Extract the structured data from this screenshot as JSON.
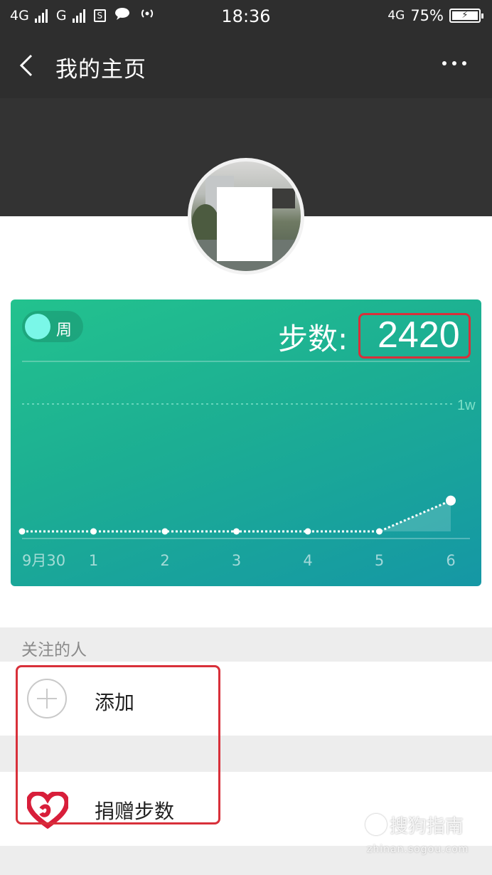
{
  "status_bar": {
    "network1": "4G",
    "network2": "G",
    "icon_s": "S",
    "time": "18:36",
    "network_right": "4G",
    "battery": "75%"
  },
  "nav": {
    "title": "我的主页"
  },
  "card": {
    "toggle_label": "周",
    "steps_label": "步数:",
    "steps_value": "2420"
  },
  "chart_data": {
    "type": "line",
    "x_labels": [
      "9月30",
      "1",
      "2",
      "3",
      "4",
      "5",
      "6"
    ],
    "values": [
      0,
      0,
      0,
      0,
      0,
      0,
      2420
    ],
    "reference_line": {
      "label": "1w",
      "value": 10000
    },
    "ylim": [
      0,
      13400
    ],
    "grid": false,
    "colors": {
      "line": "#ffffff",
      "reference": "#7fe0c8"
    }
  },
  "following": {
    "header": "关注的人",
    "add_label": "添加"
  },
  "donate": {
    "label": "捐赠步数"
  },
  "watermark": {
    "logo": "S",
    "text": "搜狗指南",
    "url": "zhinan.sogou.com"
  },
  "colors": {
    "header_bg": "#2e2e2e",
    "card_gradient_start": "#23c28e",
    "card_gradient_end": "#1597a5",
    "highlight": "#d8303a"
  }
}
